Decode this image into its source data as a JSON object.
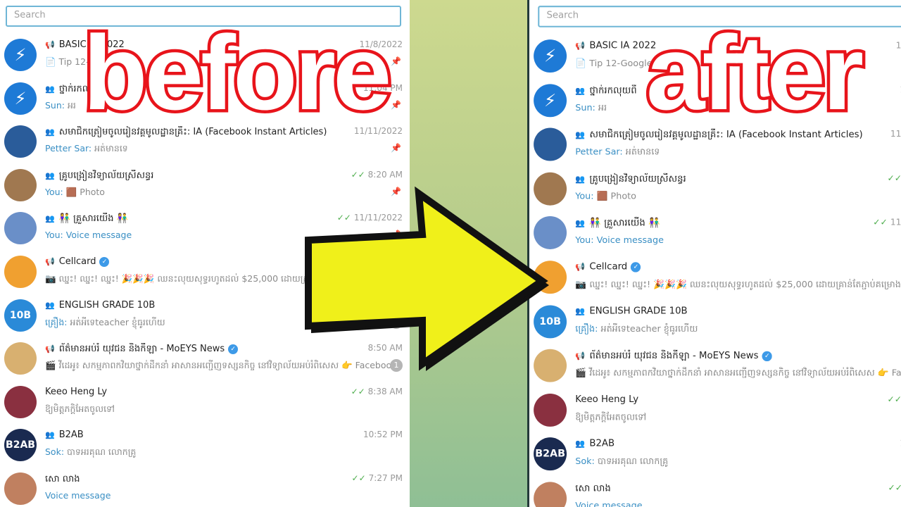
{
  "search": {
    "placeholder": "Search"
  },
  "overlay": {
    "before": "before",
    "after": "after"
  },
  "colors": {
    "accent": "#6fb6d6",
    "sender": "#3a8fc4",
    "check": "#4fae4e",
    "overlay_red": "#e8141b",
    "arrow_yellow": "#f0f01a"
  },
  "chats": [
    {
      "icon": "megaphone-icon",
      "title": "BASIC IA 2022",
      "time": "11/8/2022",
      "preview": "📄 Tip 12-Google",
      "pinned": true,
      "avatar": "lightning",
      "avatar_color": "#1e7ad6"
    },
    {
      "icon": "group-icon",
      "title": "ថ្នាក់រកលុយពី",
      "time": "11:04 PM",
      "sender": "Sun:",
      "preview": "អរ",
      "pinned": true,
      "avatar": "lightning",
      "avatar_color": "#1e7ad6"
    },
    {
      "icon": "group-icon",
      "title": "សមាជិកត្រៀមចូលរៀនវគ្គមូលដ្ឋានគ្រឹះ: IA (Facebook Instant Articles)",
      "time": "11/11/2022",
      "sender": "Petter Sar:",
      "preview": "អត់មានទេ",
      "pinned": true,
      "avatar": "",
      "avatar_color": "#2a5c9a"
    },
    {
      "icon": "group-icon",
      "title": "គ្រូបង្រៀនវិទ្យាល័យស្រីសន្ធរ",
      "time": "8:20 AM",
      "read": true,
      "sender": "You:",
      "preview": "🟫 Photo",
      "pinned": true,
      "avatar": "",
      "avatar_color": "#a07850"
    },
    {
      "icon": "group-icon",
      "title": "👫 គ្រួសារយើង 👫",
      "time": "11/11/2022",
      "read": true,
      "sender": "You:",
      "preview": "Voice message",
      "preview_colored": true,
      "pinned": true,
      "avatar": "",
      "avatar_color": "#6a8fc8"
    },
    {
      "icon": "megaphone-icon",
      "title": "Cellcard",
      "verified": true,
      "time": "",
      "preview": "📷 ឈ្នះ! ឈ្នះ! ឈ្នះ! 🎉🎉🎉 ឈនះលុយសុទ្ធរហូតដល់ $25,000 ដោយគ្រាន់តែភ្ជាប់គម្រោង Time To R",
      "avatar": "",
      "avatar_color": "#f0a030"
    },
    {
      "icon": "group-icon",
      "title": "ENGLISH GRADE 10B",
      "time": "",
      "sender": "គ្រឿង:",
      "preview": "អត់អីទេteacher ខ្ញុំធូរហើយ",
      "badge": "1",
      "avatar": "10B",
      "avatar_color": "#2a8ad8"
    },
    {
      "icon": "megaphone-icon",
      "title": "ព័ត៌មានអប់រំ យុវជន និងកីឡា - MoEYS News",
      "verified": true,
      "time": "8:50 AM",
      "preview": "🎬 វីដេអូ៖ សកម្មភាពកវិយាថ្នាក់ដឹកនាំ អាសានអញ្ជើញទស្សនកិច្ច នៅវិទ្យាល័យអប់រំពិសេស 👉 Facebook | YouTube | Instagra...",
      "badge": "1",
      "avatar": "",
      "avatar_color": "#d8b070"
    },
    {
      "icon": "",
      "title": "Keeo Heng Ly",
      "time": "8:38 AM",
      "read": true,
      "preview": "ឱ្យមិត្តភក្តិអែតចូលទៅ",
      "avatar": "",
      "avatar_color": "#8a3040"
    },
    {
      "icon": "group-icon",
      "title": "B2AB",
      "time": "10:52 PM",
      "sender": "Sok:",
      "preview": "បាទអរគុណ លោកគ្រូ",
      "avatar": "B2AB",
      "avatar_color": "#1a2a50"
    },
    {
      "icon": "",
      "title": "សោ លាង",
      "time": "7:27 PM",
      "read": true,
      "preview": "Voice message",
      "preview_colored": true,
      "avatar": "",
      "avatar_color": "#c08060"
    }
  ]
}
